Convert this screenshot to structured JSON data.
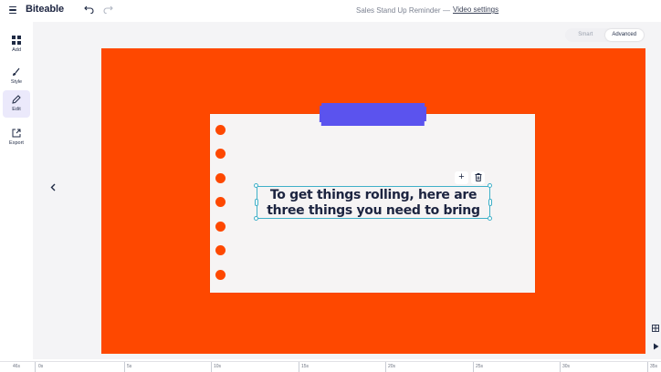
{
  "app": {
    "logo": "Biteable"
  },
  "header": {
    "project_title": "Sales Stand Up Reminder",
    "separator": "—",
    "video_settings": "Video settings",
    "undo_icon": "undo-icon",
    "redo_icon": "redo-icon"
  },
  "sidebar": {
    "items": [
      {
        "label": "Add",
        "icon": "grid-icon"
      },
      {
        "label": "Style",
        "icon": "brush-icon"
      },
      {
        "label": "Edit",
        "icon": "pencil-icon"
      },
      {
        "label": "Export",
        "icon": "export-icon"
      }
    ],
    "active": "Edit",
    "collapse_icon": "chevron-left-icon"
  },
  "mode_toggle": {
    "options": [
      "Smart",
      "Advanced"
    ],
    "selected": "Advanced"
  },
  "scene": {
    "text": "To get things rolling, here are three things you need to bring",
    "stage_color": "#fe4800",
    "paper_color": "#f6f4f4",
    "tape_color": "#5b53ee",
    "text_color": "#1c2440",
    "selection_color": "#3fb0c8"
  },
  "text_tools": {
    "add_icon": "plus-icon",
    "delete_icon": "trash-icon"
  },
  "right_tools": {
    "grid_icon": "grid-view-icon",
    "play_icon": "play-icon"
  },
  "timeline": {
    "total": "46s",
    "ticks": [
      "0s",
      "5s",
      "10s",
      "15s",
      "20s",
      "25s",
      "30s",
      "35s"
    ]
  }
}
